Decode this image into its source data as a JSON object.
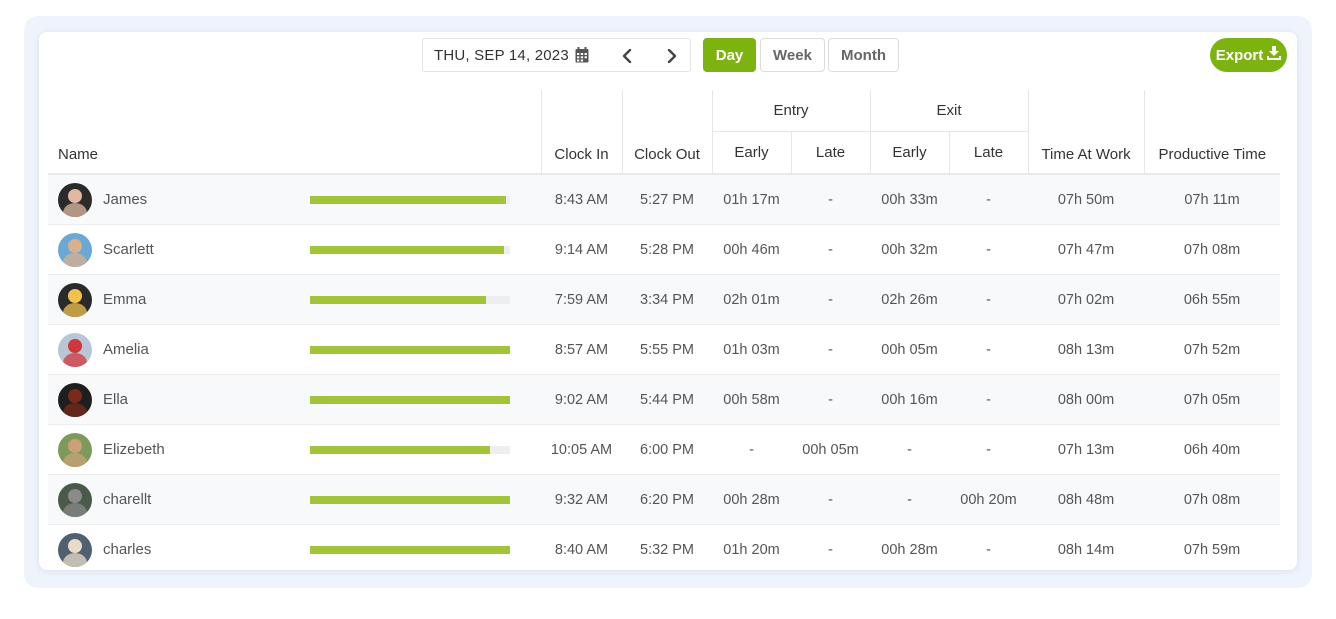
{
  "toolbar": {
    "date": "THU, SEP 14, 2023",
    "views": [
      "Day",
      "Week",
      "Month"
    ],
    "active_view": "Day",
    "export_label": "Export"
  },
  "icons": {
    "calendar": "calendar-icon",
    "prev": "chevron-left-icon",
    "next": "chevron-right-icon",
    "export": "download-icon"
  },
  "colors": {
    "accent": "#7cb30f",
    "bar_fill": "#a2c43a",
    "early_text": "#1a8a1a",
    "late_text": "#e02020"
  },
  "table": {
    "headers": {
      "name": "Name",
      "clock_in": "Clock In",
      "clock_out": "Clock Out",
      "entry": "Entry",
      "exit": "Exit",
      "early": "Early",
      "late": "Late",
      "time_at_work": "Time At Work",
      "productive_time": "Productive Time"
    },
    "rows": [
      {
        "name": "James",
        "progress": 0.98,
        "clock_in": "8:43 AM",
        "clock_out": "5:27 PM",
        "entry_early": "01h 17m",
        "entry_late": "-",
        "exit_early": "00h 33m",
        "exit_late": "-",
        "time_at_work": "07h 50m",
        "productive_time": "07h 11m"
      },
      {
        "name": "Scarlett",
        "progress": 0.97,
        "clock_in": "9:14 AM",
        "clock_out": "5:28 PM",
        "entry_early": "00h 46m",
        "entry_late": "-",
        "exit_early": "00h 32m",
        "exit_late": "-",
        "time_at_work": "07h 47m",
        "productive_time": "07h 08m"
      },
      {
        "name": "Emma",
        "progress": 0.88,
        "clock_in": "7:59 AM",
        "clock_out": "3:34 PM",
        "entry_early": "02h 01m",
        "entry_late": "-",
        "exit_early": "02h 26m",
        "exit_late": "-",
        "time_at_work": "07h 02m",
        "productive_time": "06h 55m"
      },
      {
        "name": "Amelia",
        "progress": 1.0,
        "clock_in": "8:57 AM",
        "clock_out": "5:55 PM",
        "entry_early": "01h 03m",
        "entry_late": "-",
        "exit_early": "00h 05m",
        "exit_late": "-",
        "time_at_work": "08h 13m",
        "productive_time": "07h 52m"
      },
      {
        "name": "Ella",
        "progress": 1.0,
        "clock_in": "9:02 AM",
        "clock_out": "5:44 PM",
        "entry_early": "00h 58m",
        "entry_late": "-",
        "exit_early": "00h 16m",
        "exit_late": "-",
        "time_at_work": "08h 00m",
        "productive_time": "07h 05m"
      },
      {
        "name": "Elizebeth",
        "progress": 0.9,
        "clock_in": "10:05 AM",
        "clock_out": "6:00 PM",
        "entry_early": "-",
        "entry_late": "00h 05m",
        "exit_early": "-",
        "exit_late": "-",
        "time_at_work": "07h 13m",
        "productive_time": "06h 40m"
      },
      {
        "name": "charellt",
        "progress": 1.0,
        "clock_in": "9:32 AM",
        "clock_out": "6:20 PM",
        "entry_early": "00h 28m",
        "entry_late": "-",
        "exit_early": "-",
        "exit_late": "00h 20m",
        "time_at_work": "08h 48m",
        "productive_time": "07h 08m"
      },
      {
        "name": "charles",
        "progress": 1.0,
        "clock_in": "8:40 AM",
        "clock_out": "5:32 PM",
        "entry_early": "01h 20m",
        "entry_late": "-",
        "exit_early": "00h 28m",
        "exit_late": "-",
        "time_at_work": "08h 14m",
        "productive_time": "07h 59m"
      }
    ]
  }
}
